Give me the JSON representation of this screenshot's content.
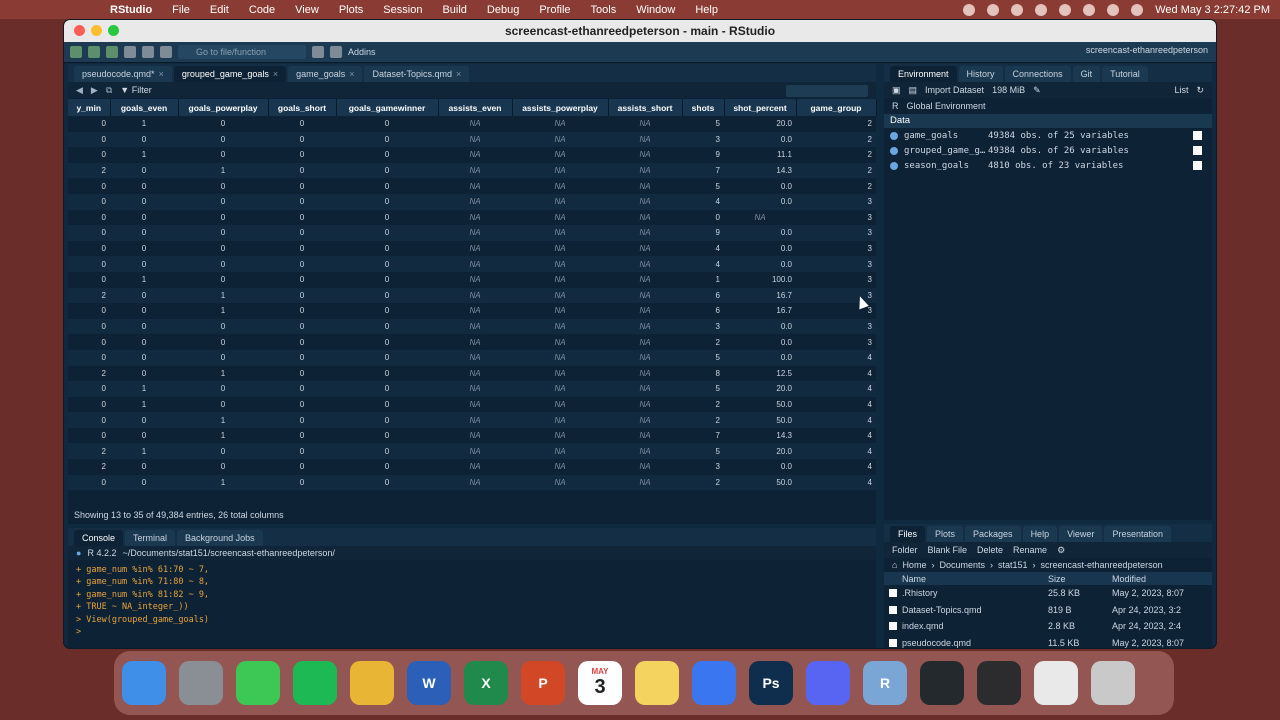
{
  "menubar": {
    "app": "RStudio",
    "items": [
      "File",
      "Edit",
      "Code",
      "View",
      "Plots",
      "Session",
      "Build",
      "Debug",
      "Profile",
      "Tools",
      "Window",
      "Help"
    ],
    "clock": "Wed May 3  2:27:42 PM"
  },
  "window": {
    "title": "screencast-ethanreedpeterson - main - RStudio"
  },
  "toolbar": {
    "goto_placeholder": "Go to file/function",
    "addins": "Addins",
    "project": "screencast-ethanreedpeterson"
  },
  "source": {
    "tabs": [
      {
        "label": "pseudocode.qmd*"
      },
      {
        "label": "grouped_game_goals"
      },
      {
        "label": "game_goals"
      },
      {
        "label": "Dataset-Topics.qmd"
      }
    ],
    "filter_label": "Filter",
    "columns": [
      "y_min",
      "goals_even",
      "goals_powerplay",
      "goals_short",
      "goals_gamewinner",
      "assists_even",
      "assists_powerplay",
      "assists_short",
      "shots",
      "shot_percent",
      "game_group"
    ],
    "rows": [
      [
        "0",
        "1",
        "0",
        "0",
        "0",
        "NA",
        "NA",
        "NA",
        "5",
        "20.0",
        "2"
      ],
      [
        "0",
        "0",
        "0",
        "0",
        "0",
        "NA",
        "NA",
        "NA",
        "3",
        "0.0",
        "2"
      ],
      [
        "0",
        "1",
        "0",
        "0",
        "0",
        "NA",
        "NA",
        "NA",
        "9",
        "11.1",
        "2"
      ],
      [
        "2",
        "0",
        "1",
        "0",
        "0",
        "NA",
        "NA",
        "NA",
        "7",
        "14.3",
        "2"
      ],
      [
        "0",
        "0",
        "0",
        "0",
        "0",
        "NA",
        "NA",
        "NA",
        "5",
        "0.0",
        "2"
      ],
      [
        "0",
        "0",
        "0",
        "0",
        "0",
        "NA",
        "NA",
        "NA",
        "4",
        "0.0",
        "3"
      ],
      [
        "0",
        "0",
        "0",
        "0",
        "0",
        "NA",
        "NA",
        "NA",
        "0",
        "NA",
        "3"
      ],
      [
        "0",
        "0",
        "0",
        "0",
        "0",
        "NA",
        "NA",
        "NA",
        "9",
        "0.0",
        "3"
      ],
      [
        "0",
        "0",
        "0",
        "0",
        "0",
        "NA",
        "NA",
        "NA",
        "4",
        "0.0",
        "3"
      ],
      [
        "0",
        "0",
        "0",
        "0",
        "0",
        "NA",
        "NA",
        "NA",
        "4",
        "0.0",
        "3"
      ],
      [
        "0",
        "1",
        "0",
        "0",
        "0",
        "NA",
        "NA",
        "NA",
        "1",
        "100.0",
        "3"
      ],
      [
        "2",
        "0",
        "1",
        "0",
        "0",
        "NA",
        "NA",
        "NA",
        "6",
        "16.7",
        "3"
      ],
      [
        "0",
        "0",
        "1",
        "0",
        "0",
        "NA",
        "NA",
        "NA",
        "6",
        "16.7",
        "3"
      ],
      [
        "0",
        "0",
        "0",
        "0",
        "0",
        "NA",
        "NA",
        "NA",
        "3",
        "0.0",
        "3"
      ],
      [
        "0",
        "0",
        "0",
        "0",
        "0",
        "NA",
        "NA",
        "NA",
        "2",
        "0.0",
        "3"
      ],
      [
        "0",
        "0",
        "0",
        "0",
        "0",
        "NA",
        "NA",
        "NA",
        "5",
        "0.0",
        "4"
      ],
      [
        "2",
        "0",
        "1",
        "0",
        "0",
        "NA",
        "NA",
        "NA",
        "8",
        "12.5",
        "4"
      ],
      [
        "0",
        "1",
        "0",
        "0",
        "0",
        "NA",
        "NA",
        "NA",
        "5",
        "20.0",
        "4"
      ],
      [
        "0",
        "1",
        "0",
        "0",
        "0",
        "NA",
        "NA",
        "NA",
        "2",
        "50.0",
        "4"
      ],
      [
        "0",
        "0",
        "1",
        "0",
        "0",
        "NA",
        "NA",
        "NA",
        "2",
        "50.0",
        "4"
      ],
      [
        "0",
        "0",
        "1",
        "0",
        "0",
        "NA",
        "NA",
        "NA",
        "7",
        "14.3",
        "4"
      ],
      [
        "2",
        "1",
        "0",
        "0",
        "0",
        "NA",
        "NA",
        "NA",
        "5",
        "20.0",
        "4"
      ],
      [
        "2",
        "0",
        "0",
        "0",
        "0",
        "NA",
        "NA",
        "NA",
        "3",
        "0.0",
        "4"
      ],
      [
        "0",
        "0",
        "1",
        "0",
        "0",
        "NA",
        "NA",
        "NA",
        "2",
        "50.0",
        "4"
      ]
    ],
    "status": "Showing 13 to 35 of 49,384 entries, 26 total columns"
  },
  "console": {
    "tabs": [
      "Console",
      "Terminal",
      "Background Jobs"
    ],
    "r_version": "R 4.2.2",
    "path": "~/Documents/stat151/screencast-ethanreedpeterson/",
    "lines": [
      "+     game_num %in% 61:70 ~ 7,",
      "+     game_num %in% 71:80 ~ 8,",
      "+     game_num %in% 81:82 ~ 9,",
      "+     TRUE ~ NA_integer_))",
      "> View(grouped_game_goals)",
      ">"
    ]
  },
  "environment": {
    "tabs": [
      "Environment",
      "History",
      "Connections",
      "Git",
      "Tutorial"
    ],
    "import": "Import Dataset",
    "memory": "198 MiB",
    "view_mode": "List",
    "lang": "R",
    "scope": "Global Environment",
    "section": "Data",
    "items": [
      {
        "name": "game_goals",
        "desc": "49384 obs. of 25 variables"
      },
      {
        "name": "grouped_game_g…",
        "desc": "49384 obs. of 26 variables"
      },
      {
        "name": "season_goals",
        "desc": "4810 obs. of 23 variables"
      }
    ]
  },
  "files": {
    "tabs": [
      "Files",
      "Plots",
      "Packages",
      "Help",
      "Viewer",
      "Presentation"
    ],
    "actions": [
      "Folder",
      "Blank File",
      "Delete",
      "Rename"
    ],
    "breadcrumb": [
      "Home",
      "Documents",
      "stat151",
      "screencast-ethanreedpeterson"
    ],
    "headers": [
      "Name",
      "Size",
      "Modified"
    ],
    "rows": [
      {
        "name": ".Rhistory",
        "size": "25.8 KB",
        "modified": "May 2, 2023, 8:07"
      },
      {
        "name": "Dataset-Topics.qmd",
        "size": "819 B",
        "modified": "Apr 24, 2023, 3:2"
      },
      {
        "name": "index.qmd",
        "size": "2.8 KB",
        "modified": "Apr 24, 2023, 2:4"
      },
      {
        "name": "pseudocode.qmd",
        "size": "11.5 KB",
        "modified": "May 2, 2023, 8:07"
      }
    ]
  },
  "dock": {
    "apps": [
      {
        "name": "finder",
        "color": "#3f8ee8"
      },
      {
        "name": "settings",
        "color": "#8a8f95"
      },
      {
        "name": "messages",
        "color": "#3dc855"
      },
      {
        "name": "spotify",
        "color": "#1db954"
      },
      {
        "name": "chrome",
        "color": "#e8b534"
      },
      {
        "name": "word",
        "color": "#2b5fb8",
        "glyph": "W"
      },
      {
        "name": "excel",
        "color": "#1f8a4c",
        "glyph": "X"
      },
      {
        "name": "powerpoint",
        "color": "#d24726",
        "glyph": "P"
      },
      {
        "name": "calendar",
        "color": "#ffffff",
        "glyph": "3"
      },
      {
        "name": "notes",
        "color": "#f4d35e"
      },
      {
        "name": "signal",
        "color": "#3a76f0"
      },
      {
        "name": "photoshop",
        "color": "#0f2e4d",
        "glyph": "Ps"
      },
      {
        "name": "discord",
        "color": "#5865f2"
      },
      {
        "name": "rstudio",
        "color": "#7aa6d6",
        "glyph": "R"
      },
      {
        "name": "github",
        "color": "#24292e"
      },
      {
        "name": "quicktime",
        "color": "#2c2c2e"
      },
      {
        "name": "profile",
        "color": "#e9e9e9"
      },
      {
        "name": "trash",
        "color": "#c9c9c9"
      }
    ],
    "calendar_month": "MAY"
  }
}
